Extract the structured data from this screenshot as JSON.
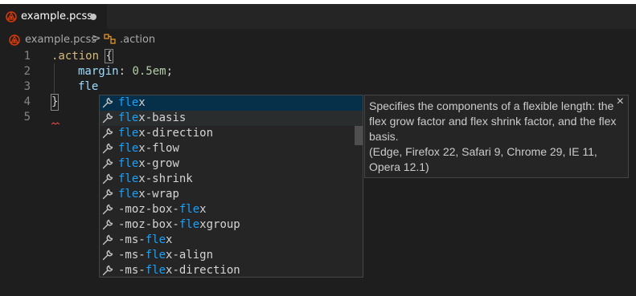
{
  "tab": {
    "title": "example.pcss",
    "dirty": true
  },
  "breadcrumb": {
    "file": "example.pcss",
    "separator": ">",
    "symbol": ".action"
  },
  "editor": {
    "line_numbers": [
      "1",
      "2",
      "3",
      "4",
      "5"
    ],
    "line1": {
      "selector": ".action",
      "brace_open": "{"
    },
    "line2": {
      "property": "margin",
      "colon": ":",
      "value": "0.5em",
      "semicolon": ";"
    },
    "line3": {
      "text": "fle"
    },
    "line4": {
      "brace_close": "}"
    }
  },
  "suggestions": [
    {
      "match": "fle",
      "rest": "x",
      "prefix": ""
    },
    {
      "match": "fle",
      "rest": "x-basis",
      "prefix": ""
    },
    {
      "match": "fle",
      "rest": "x-direction",
      "prefix": ""
    },
    {
      "match": "fle",
      "rest": "x-flow",
      "prefix": ""
    },
    {
      "match": "fle",
      "rest": "x-grow",
      "prefix": ""
    },
    {
      "match": "fle",
      "rest": "x-shrink",
      "prefix": ""
    },
    {
      "match": "fle",
      "rest": "x-wrap",
      "prefix": ""
    },
    {
      "prefix": "-moz-box-",
      "match": "fle",
      "rest": "x"
    },
    {
      "prefix": "-moz-box-",
      "match": "fle",
      "rest": "xgroup"
    },
    {
      "prefix": "-ms-",
      "match": "fle",
      "rest": "x"
    },
    {
      "prefix": "-ms-",
      "match": "fle",
      "rest": "x-align"
    },
    {
      "prefix": "-ms-",
      "match": "fle",
      "rest": "x-direction"
    }
  ],
  "details": {
    "description": "Specifies the components of a flexible length: the flex grow factor and flex shrink factor, and the flex basis.",
    "browsers": "(Edge, Firefox 22, Safari 9, Chrome 29, IE 11, Opera 12.1)",
    "close": "×"
  },
  "colors": {
    "accent_highlight": "#18a3ff",
    "selector": "#d7ba7d",
    "property": "#9cdcfe",
    "number": "#b5cea8"
  }
}
